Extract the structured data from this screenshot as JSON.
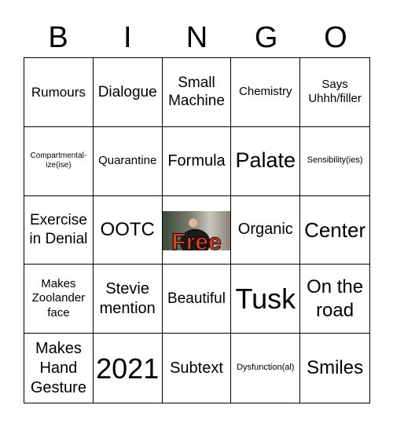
{
  "header": [
    "B",
    "I",
    "N",
    "G",
    "O"
  ],
  "cells": [
    "Rumours",
    "Dialogue",
    "Small Machine",
    "Chemistry",
    "Says Uhhh/filler",
    "Compartmental-ize(ise)",
    "Quarantine",
    "Formula",
    "Palate",
    "Sensibility(ies)",
    "Exercise in Denial",
    "OOTC",
    "Free",
    "Organic",
    "Center",
    "Makes Zoolander face",
    "Stevie mention",
    "Beautiful",
    "Tusk",
    "On the road",
    "Makes Hand Gesture",
    "2021",
    "Subtext",
    "Dysfunction(al)",
    "Smiles"
  ],
  "free_color": "#e0401c"
}
